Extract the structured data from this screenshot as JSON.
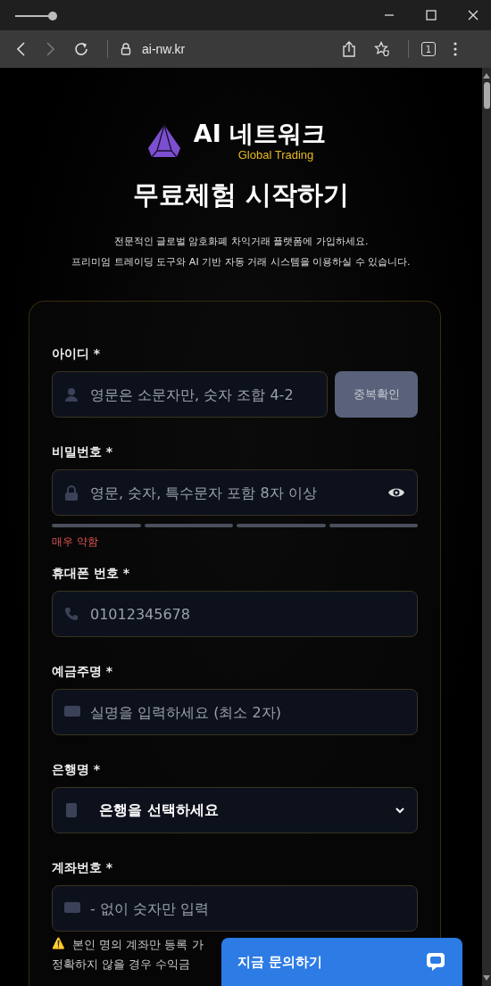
{
  "browser": {
    "url": "ai-nw.kr",
    "tab_count": "1",
    "forward_disabled": true
  },
  "brand": {
    "name": "AI 네트워크",
    "tagline": "Global Trading"
  },
  "heading": "무료체험 시작하기",
  "intro": [
    "전문적인 글로벌 암호화폐 차익거래 플랫폼에 가입하세요.",
    "프리미엄 트레이딩 도구와 AI 기반 자동 거래 시스템을 이용하실 수 있습니다."
  ],
  "fields": [
    {
      "kind": "id",
      "label": "아이디 *",
      "placeholder": "영문은 소문자만, 숫자 조합 4-2",
      "button": "중복확인"
    },
    {
      "kind": "password",
      "label": "비밀번호 *",
      "placeholder": "영문, 숫자, 특수문자 포함 8자 이상",
      "strength": {
        "label": "매우 약함"
      }
    },
    {
      "kind": "phone",
      "label": "휴대폰 번호 *",
      "placeholder": "01012345678"
    },
    {
      "kind": "name",
      "label": "예금주명 *",
      "placeholder": "실명을 입력하세요 (최소 2자)"
    },
    {
      "kind": "select",
      "label": "은행명 *",
      "value": "은행을 선택하세요"
    },
    {
      "kind": "account",
      "label": "계좌번호 *",
      "placeholder": "- 없이 숫자만 입력"
    }
  ],
  "notice": {
    "icon": "⚠️",
    "lines": [
      "본인 명의 계좌만 등록 가",
      "정확하지 않을 경우 수익금"
    ]
  },
  "chat_button": {
    "label": "지금 문의하기"
  }
}
